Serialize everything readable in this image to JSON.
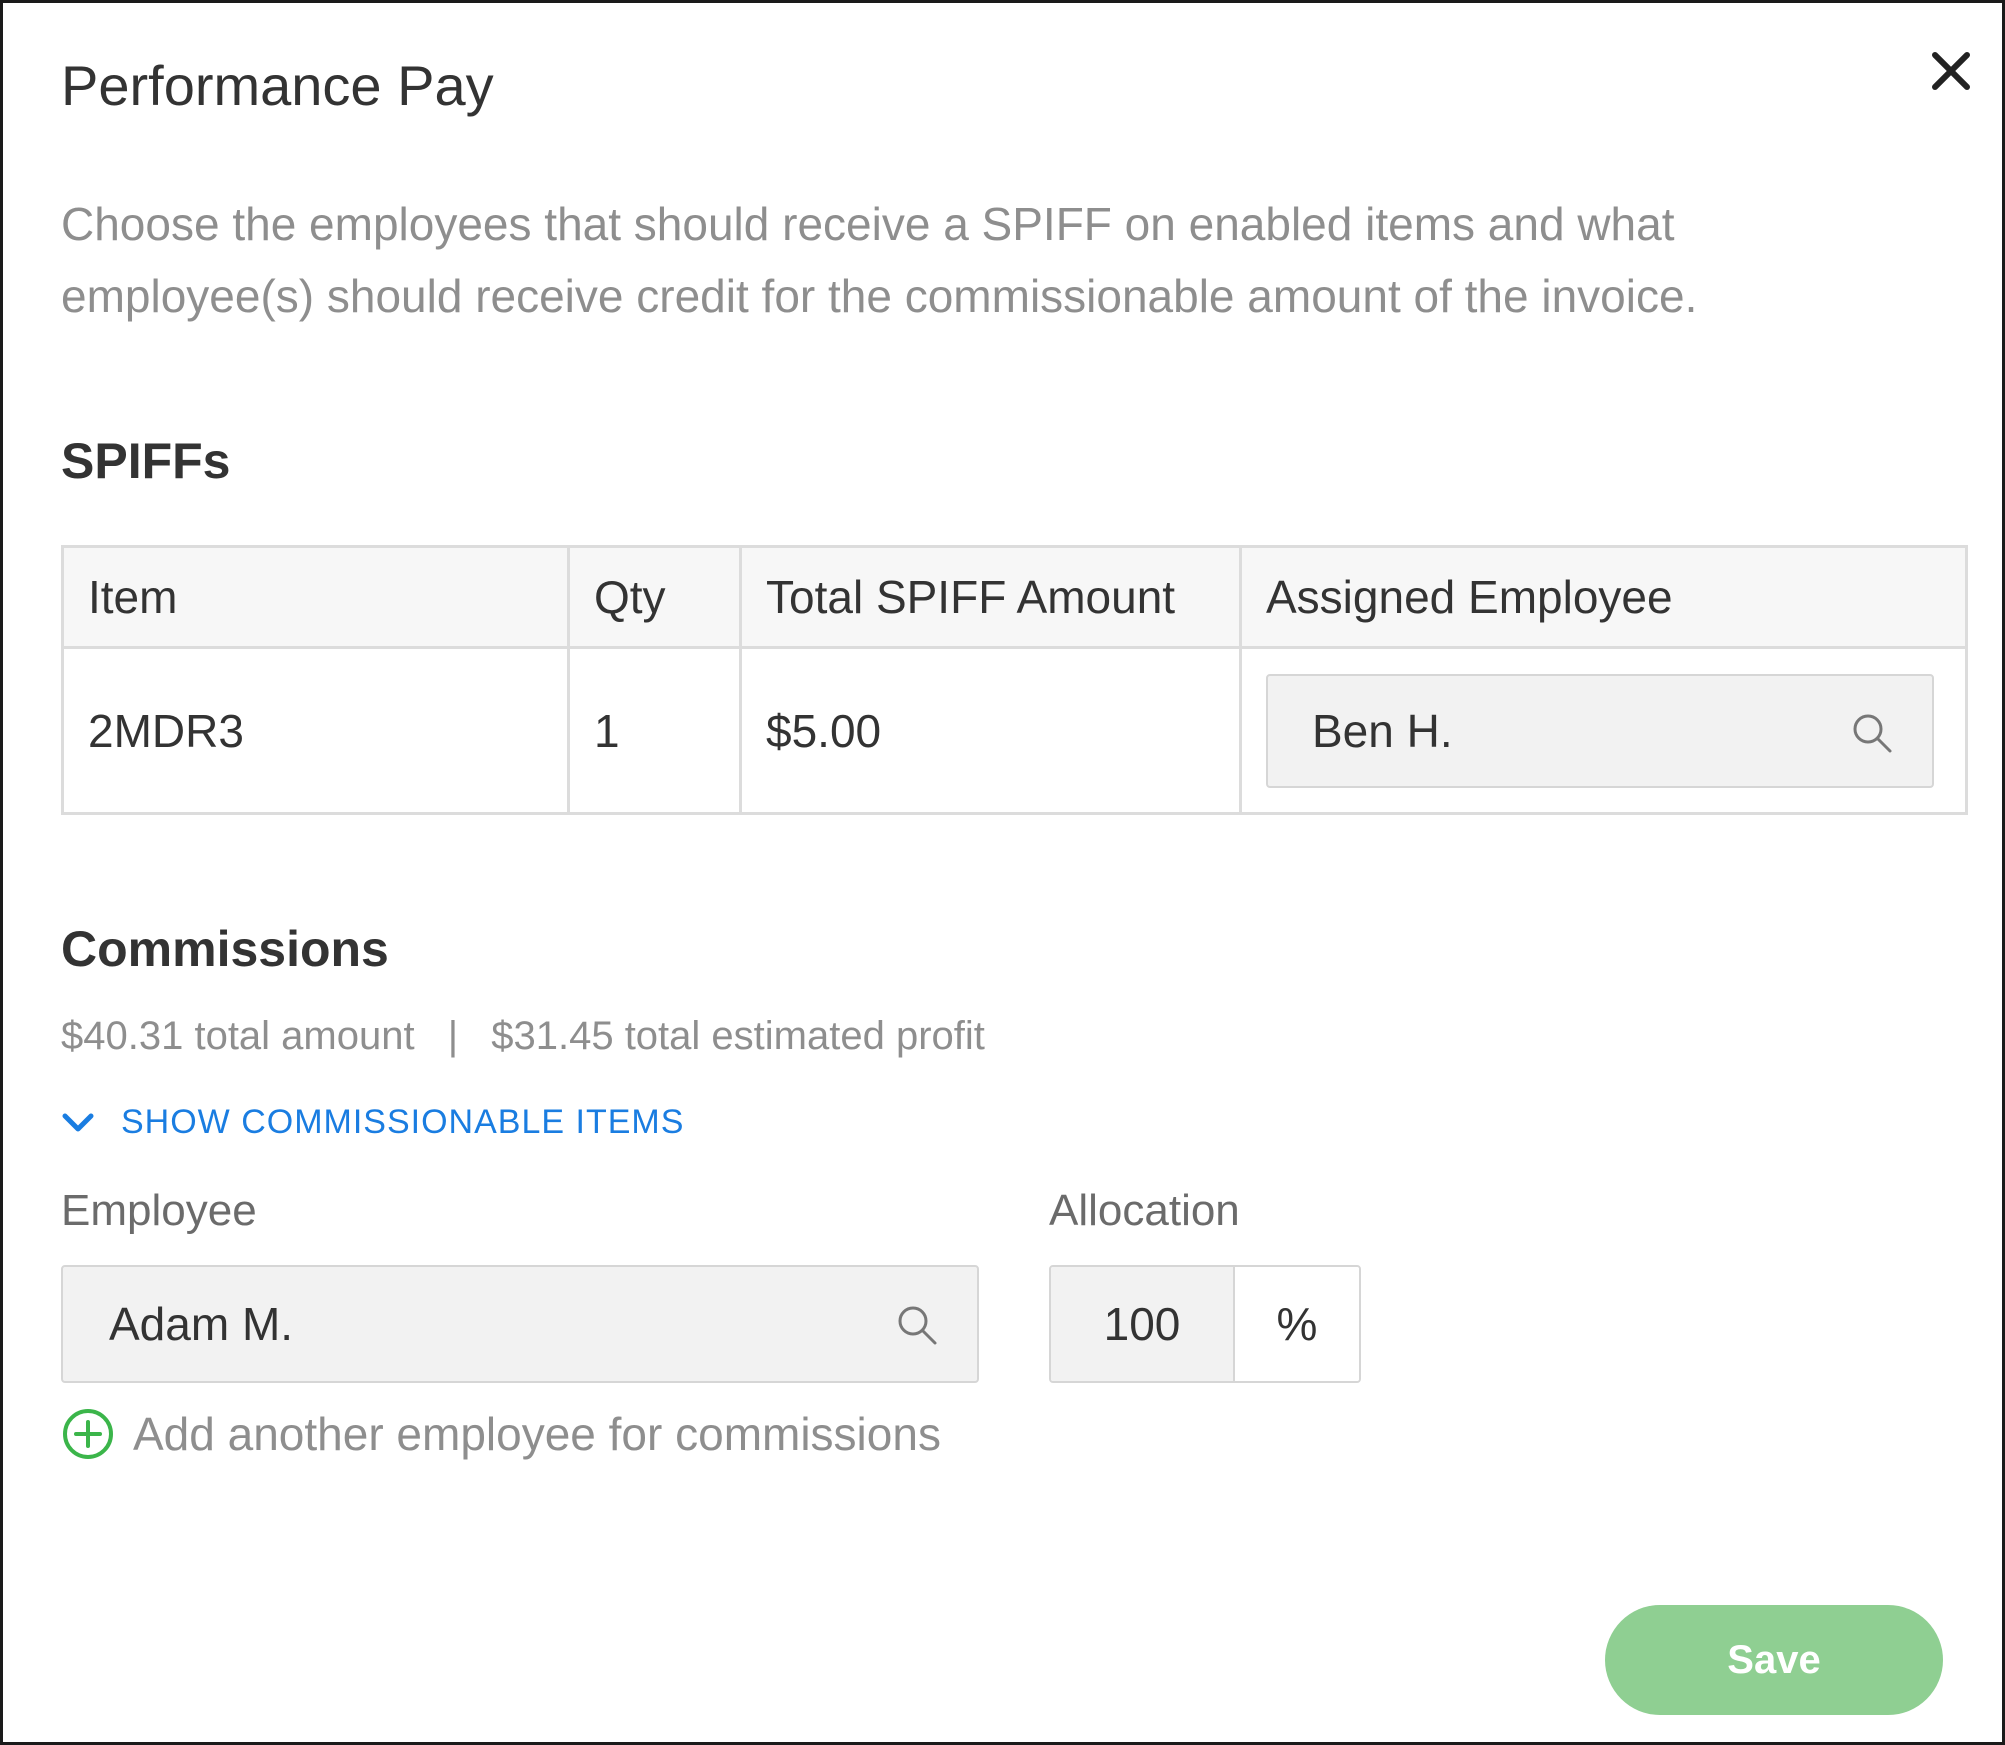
{
  "dialog": {
    "title": "Performance Pay",
    "description": "Choose the employees that should receive a SPIFF on enabled items and what employee(s) should receive credit for the commissionable amount of the invoice.",
    "close_icon": "close-icon"
  },
  "spiffs": {
    "heading": "SPIFFs",
    "columns": [
      "Item",
      "Qty",
      "Total SPIFF Amount",
      "Assigned Employee"
    ],
    "rows": [
      {
        "item": "2MDR3",
        "qty": "1",
        "amount": "$5.00",
        "employee": "Ben H."
      }
    ]
  },
  "commissions": {
    "heading": "Commissions",
    "total_amount": "$40.31 total amount",
    "separator": "|",
    "total_profit": "$31.45 total estimated profit",
    "toggle_label": "SHOW COMMISSIONABLE ITEMS",
    "employee_label": "Employee",
    "employee_value": "Adam M.",
    "allocation_label": "Allocation",
    "allocation_value": "100",
    "allocation_unit": "%",
    "add_employee_label": "Add another employee for commissions"
  },
  "footer": {
    "save_label": "Save"
  },
  "colors": {
    "accent_blue": "#1a7de1",
    "save_green": "#8fcf92",
    "add_icon_green": "#3bb54a"
  }
}
